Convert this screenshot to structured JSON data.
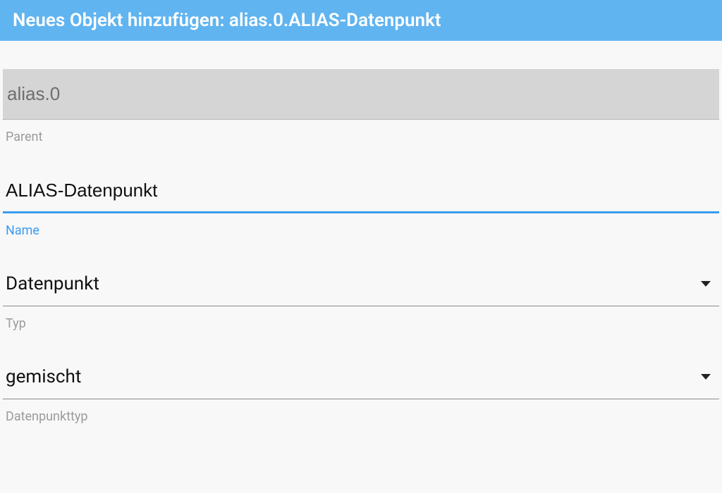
{
  "header": {
    "title": "Neues Objekt hinzufügen: alias.0.ALIAS-Datenpunkt"
  },
  "fields": {
    "parent": {
      "value": "alias.0",
      "label": "Parent"
    },
    "name": {
      "value": "ALIAS-Datenpunkt",
      "label": "Name"
    },
    "type": {
      "value": "Datenpunkt",
      "label": "Typ"
    },
    "datapointType": {
      "value": "gemischt",
      "label": "Datenpunkttyp"
    }
  }
}
